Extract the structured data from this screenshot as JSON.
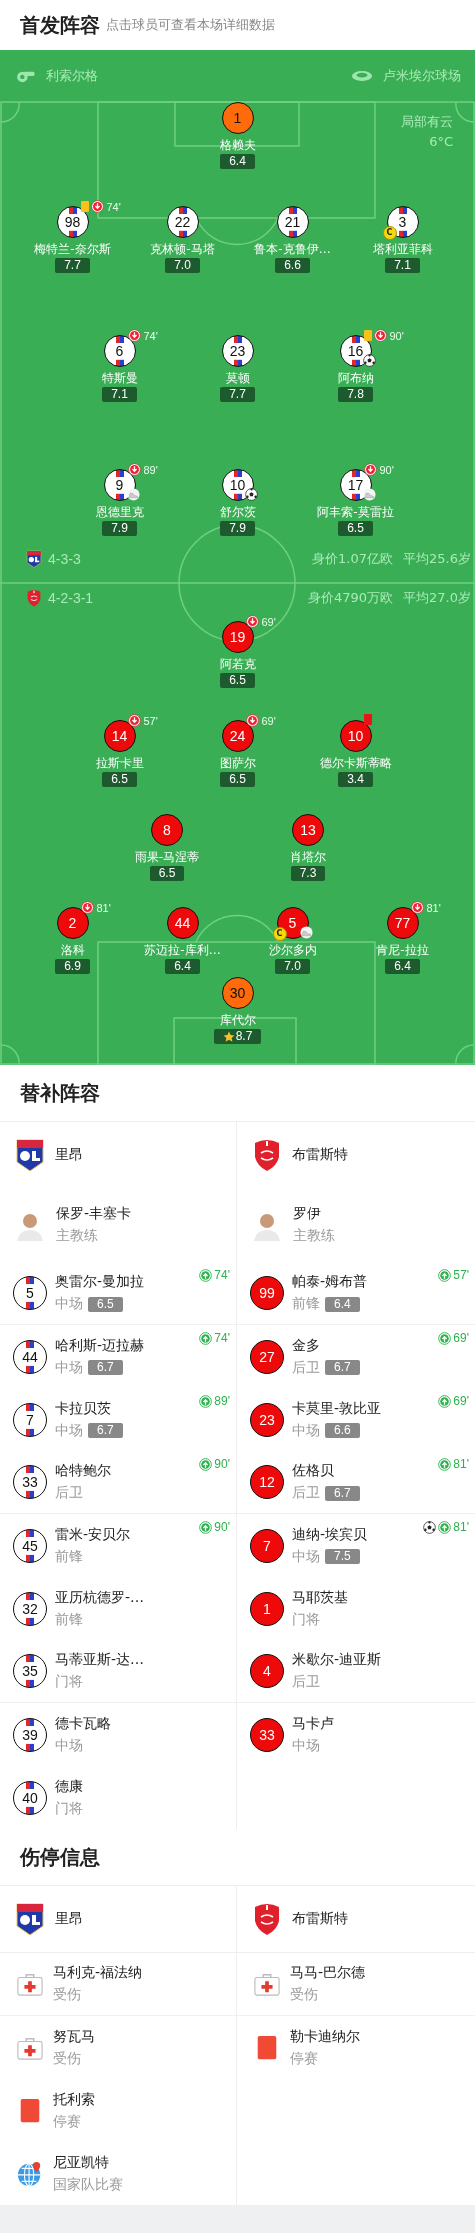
{
  "lineup": {
    "title": "首发阵容",
    "hint": "点击球员可查看本场详细数据"
  },
  "pitch": {
    "referee": "利索尔格",
    "stadium": "卢米埃尔球场",
    "weather": "局部有云",
    "temperature": "6°C",
    "home": {
      "formation": "4-3-3",
      "value": "身价1.07亿欧",
      "age": "平均25.6岁",
      "lines": [
        {
          "players": [
            {
              "number": "1",
              "name": "格赖夫",
              "rating": "6.4",
              "kind": "keeper"
            }
          ]
        },
        {
          "players": [
            {
              "number": "98",
              "name": "梅特兰-奈尔斯",
              "rating": "7.7",
              "kind": "striped",
              "events": [
                {
                  "kind": "yellow"
                },
                {
                  "kind": "sub_off",
                  "minute": "74'"
                }
              ]
            },
            {
              "number": "22",
              "name": "克林顿-马塔",
              "rating": "7.0",
              "kind": "striped"
            },
            {
              "number": "21",
              "name": "鲁本-克鲁伊…",
              "rating": "6.6",
              "kind": "striped"
            },
            {
              "number": "3",
              "name": "塔利亚菲科",
              "rating": "7.1",
              "kind": "striped",
              "events": [
                {
                  "kind": "captain",
                  "label": "C"
                }
              ]
            }
          ]
        },
        {
          "players": [
            {
              "number": "6",
              "name": "特斯曼",
              "rating": "7.1",
              "kind": "striped",
              "events": [
                {
                  "kind": "sub_off",
                  "minute": "74'"
                }
              ]
            },
            {
              "number": "23",
              "name": "莫顿",
              "rating": "7.7",
              "kind": "striped"
            },
            {
              "number": "16",
              "name": "阿布纳",
              "rating": "7.8",
              "kind": "striped",
              "events": [
                {
                  "kind": "yellow"
                },
                {
                  "kind": "sub_off",
                  "minute": "90'"
                },
                {
                  "kind": "goal"
                }
              ]
            }
          ]
        },
        {
          "players": [
            {
              "number": "9",
              "name": "恩德里克",
              "rating": "7.9",
              "kind": "striped",
              "events": [
                {
                  "kind": "sub_off",
                  "minute": "89'"
                },
                {
                  "kind": "assist"
                }
              ]
            },
            {
              "number": "10",
              "name": "舒尔茨",
              "rating": "7.9",
              "kind": "striped",
              "events": [
                {
                  "kind": "goal"
                }
              ]
            },
            {
              "number": "17",
              "name": "阿丰索-莫雷拉",
              "rating": "6.5",
              "kind": "striped",
              "events": [
                {
                  "kind": "sub_off",
                  "minute": "90'"
                },
                {
                  "kind": "assist"
                }
              ]
            }
          ]
        }
      ]
    },
    "away": {
      "formation": "4-2-3-1",
      "value": "身价4790万欧",
      "age": "平均27.0岁",
      "lines": [
        {
          "players": [
            {
              "number": "19",
              "name": "阿若克",
              "rating": "6.5",
              "kind": "red",
              "events": [
                {
                  "kind": "sub_off",
                  "minute": "69'"
                }
              ]
            }
          ]
        },
        {
          "players": [
            {
              "number": "14",
              "name": "拉斯卡里",
              "rating": "6.5",
              "kind": "red",
              "events": [
                {
                  "kind": "sub_off",
                  "minute": "57'"
                }
              ]
            },
            {
              "number": "24",
              "name": "图萨尔",
              "rating": "6.5",
              "kind": "red",
              "events": [
                {
                  "kind": "sub_off",
                  "minute": "69'"
                }
              ]
            },
            {
              "number": "10",
              "name": "德尔卡斯蒂略",
              "rating": "3.4",
              "kind": "red",
              "events": [
                {
                  "kind": "red"
                }
              ]
            }
          ]
        },
        {
          "players": [
            {
              "number": "8",
              "name": "雨果-马涅蒂",
              "rating": "6.5",
              "kind": "red"
            },
            {
              "number": "13",
              "name": "肖塔尔",
              "rating": "7.3",
              "kind": "red"
            }
          ]
        },
        {
          "players": [
            {
              "number": "2",
              "name": "洛科",
              "rating": "6.9",
              "kind": "red",
              "events": [
                {
                  "kind": "sub_off",
                  "minute": "81'"
                }
              ]
            },
            {
              "number": "44",
              "name": "苏迈拉-库利…",
              "rating": "6.4",
              "kind": "red"
            },
            {
              "number": "5",
              "name": "沙尔多内",
              "rating": "7.0",
              "kind": "red",
              "events": [
                {
                  "kind": "captain",
                  "label": "C"
                },
                {
                  "kind": "assist"
                }
              ]
            },
            {
              "number": "77",
              "name": "肯尼-拉拉",
              "rating": "6.4",
              "kind": "red",
              "events": [
                {
                  "kind": "sub_off",
                  "minute": "81'"
                }
              ]
            }
          ]
        },
        {
          "players": [
            {
              "number": "30",
              "name": "库代尔",
              "rating": "8.7",
              "kind": "keeper",
              "events": [
                {
                  "kind": "mvp"
                }
              ]
            }
          ]
        }
      ]
    }
  },
  "subs": {
    "title": "替补阵容",
    "teams": [
      {
        "name": "里昂",
        "coach": {
          "name": "保罗-丰塞卡",
          "role": "主教练"
        },
        "players": [
          {
            "number": "5",
            "name": "奥雷尔-曼加拉",
            "position": "中场",
            "rating": "6.5",
            "kind": "striped",
            "events": [
              {
                "kind": "sub_on",
                "minute": "74'"
              }
            ]
          },
          {
            "number": "44",
            "name": "哈利斯-迈拉赫",
            "position": "中场",
            "rating": "6.7",
            "kind": "striped",
            "events": [
              {
                "kind": "sub_on",
                "minute": "74'"
              }
            ]
          },
          {
            "number": "7",
            "name": "卡拉贝茨",
            "position": "中场",
            "rating": "6.7",
            "kind": "striped",
            "events": [
              {
                "kind": "sub_on",
                "minute": "89'"
              }
            ]
          },
          {
            "number": "33",
            "name": "哈特鲍尔",
            "position": "后卫",
            "kind": "striped",
            "events": [
              {
                "kind": "sub_on",
                "minute": "90'"
              }
            ]
          },
          {
            "number": "45",
            "name": "雷米-安贝尔",
            "position": "前锋",
            "kind": "striped",
            "events": [
              {
                "kind": "sub_on",
                "minute": "90'"
              }
            ]
          },
          {
            "number": "32",
            "name": "亚历杭德罗-…",
            "position": "前锋",
            "kind": "striped"
          },
          {
            "number": "35",
            "name": "马蒂亚斯-达…",
            "position": "门将",
            "kind": "striped"
          },
          {
            "number": "39",
            "name": "德卡瓦略",
            "position": "中场",
            "kind": "striped"
          },
          {
            "number": "40",
            "name": "德康",
            "position": "门将",
            "kind": "striped"
          }
        ]
      },
      {
        "name": "布雷斯特",
        "coach": {
          "name": "罗伊",
          "role": "主教练"
        },
        "players": [
          {
            "number": "99",
            "name": "帕泰-姆布普",
            "position": "前锋",
            "rating": "6.4",
            "kind": "red",
            "events": [
              {
                "kind": "sub_on",
                "minute": "57'"
              }
            ]
          },
          {
            "number": "27",
            "name": "金多",
            "position": "后卫",
            "rating": "6.7",
            "kind": "red",
            "events": [
              {
                "kind": "sub_on",
                "minute": "69'"
              }
            ]
          },
          {
            "number": "23",
            "name": "卡莫里-敦比亚",
            "position": "中场",
            "rating": "6.6",
            "kind": "red",
            "events": [
              {
                "kind": "sub_on",
                "minute": "69'"
              }
            ]
          },
          {
            "number": "12",
            "name": "佐格贝",
            "position": "后卫",
            "rating": "6.7",
            "kind": "red",
            "events": [
              {
                "kind": "sub_on",
                "minute": "81'"
              }
            ]
          },
          {
            "number": "7",
            "name": "迪纳-埃宾贝",
            "position": "中场",
            "rating": "7.5",
            "kind": "red",
            "events": [
              {
                "kind": "goal"
              },
              {
                "kind": "sub_on",
                "minute": "81'"
              }
            ]
          },
          {
            "number": "1",
            "name": "马耶茨基",
            "position": "门将",
            "kind": "red"
          },
          {
            "number": "4",
            "name": "米歇尔-迪亚斯",
            "position": "后卫",
            "kind": "red"
          },
          {
            "number": "33",
            "name": "马卡卢",
            "position": "中场",
            "kind": "red"
          }
        ]
      }
    ]
  },
  "injuries": {
    "title": "伤停信息",
    "teams": [
      {
        "name": "里昂",
        "players": [
          {
            "name": "马利克-福法纳",
            "status": "受伤",
            "kind": "injury"
          },
          {
            "name": "努瓦马",
            "status": "受伤",
            "kind": "injury"
          },
          {
            "name": "托利索",
            "status": "停赛",
            "kind": "suspension"
          },
          {
            "name": "尼亚凯特",
            "status": "国家队比赛",
            "kind": "international"
          }
        ]
      },
      {
        "name": "布雷斯特",
        "players": [
          {
            "name": "马马-巴尔德",
            "status": "受伤",
            "kind": "injury"
          },
          {
            "name": "勒卡迪纳尔",
            "status": "停赛",
            "kind": "suspension"
          }
        ]
      }
    ]
  }
}
